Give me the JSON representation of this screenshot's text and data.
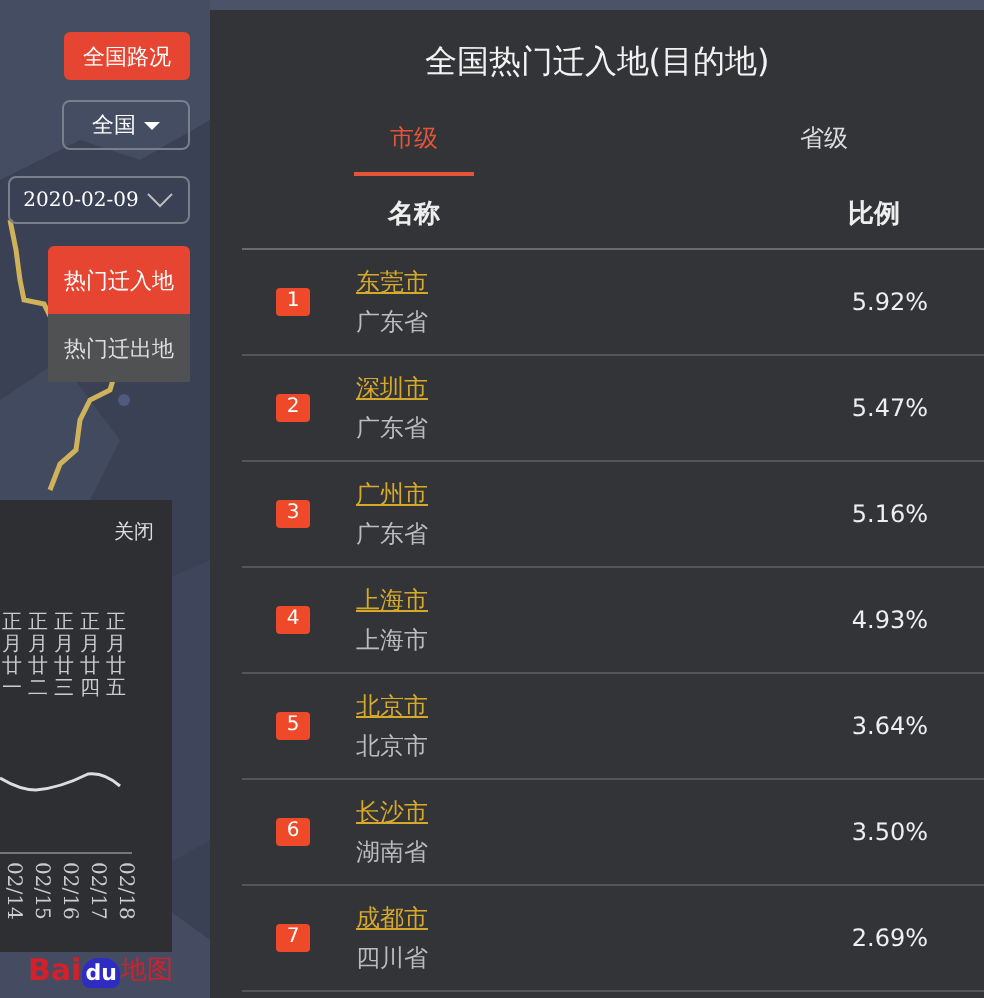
{
  "map_controls": {
    "traffic_button": "全国路况",
    "region_select": "全国",
    "date_select": "2020-02-09",
    "modes": [
      {
        "label": "热门迁入地",
        "selected": true
      },
      {
        "label": "热门迁出地",
        "selected": false
      }
    ]
  },
  "trend_panel": {
    "close": "关闭",
    "lunar_dates": [
      "正月廿一",
      "正月廿二",
      "正月廿三",
      "正月廿四",
      "正月廿五"
    ],
    "dates": [
      "02/14",
      "02/15",
      "02/16",
      "02/17",
      "02/18"
    ]
  },
  "map_logo": {
    "part_1": "Bai",
    "part_2": "du",
    "part_3": "地图"
  },
  "panel": {
    "title": "全国热门迁入地(目的地)",
    "tabs": [
      {
        "label": "市级",
        "selected": true
      },
      {
        "label": "省级",
        "selected": false
      }
    ],
    "columns": [
      "名称",
      "比例"
    ],
    "rows": [
      {
        "rank": "1",
        "city": "东莞市",
        "province": "广东省",
        "ratio": "5.92%"
      },
      {
        "rank": "2",
        "city": "深圳市",
        "province": "广东省",
        "ratio": "5.47%"
      },
      {
        "rank": "3",
        "city": "广州市",
        "province": "广东省",
        "ratio": "5.16%"
      },
      {
        "rank": "4",
        "city": "上海市",
        "province": "上海市",
        "ratio": "4.93%"
      },
      {
        "rank": "5",
        "city": "北京市",
        "province": "北京市",
        "ratio": "3.64%"
      },
      {
        "rank": "6",
        "city": "长沙市",
        "province": "湖南省",
        "ratio": "3.50%"
      },
      {
        "rank": "7",
        "city": "成都市",
        "province": "四川省",
        "ratio": "2.69%"
      }
    ]
  }
}
